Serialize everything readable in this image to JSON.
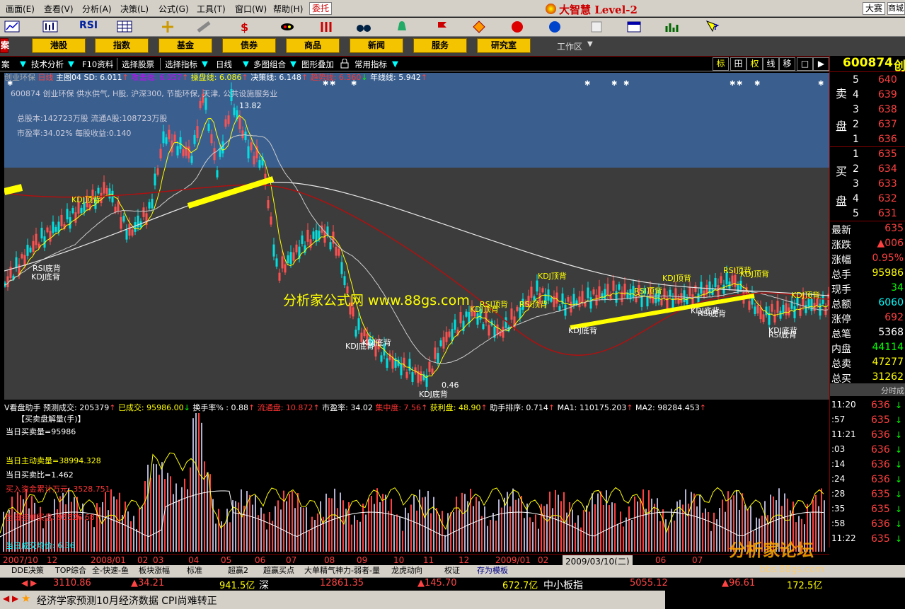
{
  "menu": {
    "items": [
      "画面(E)",
      "查看(V)",
      "分析(A)",
      "决策(L)",
      "公式(G)",
      "工具(T)",
      "窗口(W)",
      "帮助(H)"
    ],
    "trade": "委托",
    "brand": "大智慧 Level-2",
    "dasai": "大赛",
    "shangcheng": "商城"
  },
  "toolbar": {
    "icons": [
      "chart-icon",
      "kline-icon",
      "rsi-icon",
      "table-icon",
      "crosshair-icon",
      "ruler-icon",
      "dollar-icon",
      "eye-icon",
      "bars-icon",
      "binoculars-icon",
      "bell-icon",
      "flag-icon",
      "diamond-icon",
      "red-circle-icon",
      "blue-circle-icon",
      "document-icon",
      "window-icon",
      "barchart-icon",
      "help-icon"
    ],
    "rsi_label": "RSI"
  },
  "sector": {
    "left_tab": "案",
    "buttons": [
      "港股",
      "指数",
      "基金",
      "债券",
      "商品",
      "新闻",
      "服务",
      "研究室"
    ],
    "workspace": "工作区"
  },
  "funcbar": {
    "items": [
      "案",
      "技术分析",
      "F10资料",
      "选择股票",
      "选择指标",
      "日线",
      "多图组合",
      "图形叠加",
      "常用指标"
    ],
    "right_buttons": [
      "标",
      "田",
      "权",
      "线",
      "移",
      "□",
      "▶"
    ]
  },
  "stock": {
    "code": "600874",
    "name_suffix": "创",
    "chart_title": "创业环保",
    "period": "日线",
    "main_indicator": "主图04",
    "sd": "SD: 6.011",
    "attack": "攻击线: 6.057",
    "operate": "操盘线: 6.086",
    "decision": "决策线: 6.148",
    "trend": "趋势线: 6.360",
    "year": "年线线: 5.942",
    "desc": "600874 创业环保 供水供气, H股, 沪深300, 节能环保, 天津, 公共设施服务业",
    "total_shares": "总股本:142723万股  流通A股:108723万股",
    "pe": "市盈率:34.02% 每股收益:0.140",
    "high_label": "13.82",
    "low_label": "0.46",
    "watermark": "分析家公式网  www.88gs.com"
  },
  "chart_labels": [
    {
      "t": "RSI底背"
    },
    {
      "t": "KDJ底背"
    },
    {
      "t": "KDJ顶背"
    },
    {
      "t": "KDJ底背"
    },
    {
      "t": "KDJ底背"
    },
    {
      "t": "KDJ底背"
    },
    {
      "t": "KDJ顶背"
    },
    {
      "t": "RSI顶背"
    },
    {
      "t": "RSI顶背"
    },
    {
      "t": "KDJ顶背"
    },
    {
      "t": "KDJ底背"
    },
    {
      "t": "RSI顶背"
    },
    {
      "t": "KDJ顶背"
    },
    {
      "t": "KDJ底背"
    },
    {
      "t": "RSI底背"
    },
    {
      "t": "RSI顶背"
    },
    {
      "t": "KDJ顶背"
    },
    {
      "t": "KDJ顶背"
    },
    {
      "t": "KDJ底背"
    },
    {
      "t": "RSI底背"
    }
  ],
  "lower": {
    "header_parts": [
      "V看盘助手 预测成交: 205379",
      "已成交: 95986.00",
      "换手率% : 0.88",
      "流通盘: 10.872",
      "市盈率: 34.02",
      "集中度: 7.56",
      "获利盘: 48.90",
      "助手排序: 0.714",
      "MA1: 110175.203",
      "MA2: 98284.453"
    ],
    "title": "【买卖盘解量(手)】",
    "buy_vol": "当日买卖量=95986",
    "active_sell": "当日主动卖量=38994.328",
    "ratio": "当日买卖比=1.462",
    "funds": "买入资金累计万元: 3528.751",
    "pending": "当日挂单买盘: 95526.68",
    "bottom_text": "当日成交均价: 6.36"
  },
  "dates": [
    "2007/10",
    "12",
    "2008/01",
    "02",
    "03",
    "04",
    "05",
    "06",
    "07",
    "08",
    "09",
    "10",
    "11",
    "12",
    "2009/01",
    "02",
    "2009/03/10(二)",
    "06",
    "07"
  ],
  "quotes": {
    "sell_label": [
      "卖",
      "盘"
    ],
    "buy_label": [
      "买",
      "盘"
    ],
    "sells": [
      {
        "n": "5",
        "p": "640"
      },
      {
        "n": "4",
        "p": "639"
      },
      {
        "n": "3",
        "p": "638"
      },
      {
        "n": "2",
        "p": "637"
      },
      {
        "n": "1",
        "p": "636"
      }
    ],
    "buys": [
      {
        "n": "1",
        "p": "635"
      },
      {
        "n": "2",
        "p": "634"
      },
      {
        "n": "3",
        "p": "633"
      },
      {
        "n": "4",
        "p": "632"
      },
      {
        "n": "5",
        "p": "631"
      }
    ],
    "stats": [
      {
        "k": "最新",
        "v": "635",
        "c": "#ff4040"
      },
      {
        "k": "涨跌",
        "v": "▲006",
        "c": "#ff4040"
      },
      {
        "k": "涨幅",
        "v": "0.95%",
        "c": "#ff4040"
      },
      {
        "k": "总手",
        "v": "95986",
        "c": "#ffff00"
      },
      {
        "k": "现手",
        "v": "34",
        "c": "#00ff00"
      },
      {
        "k": "总额",
        "v": "6060",
        "c": "#00ffff"
      },
      {
        "k": "涨停",
        "v": "692",
        "c": "#ff4040"
      },
      {
        "k": "总笔",
        "v": "5368",
        "c": "#ffffff"
      },
      {
        "k": "内盘",
        "v": "44114",
        "c": "#00ff00"
      },
      {
        "k": "总卖",
        "v": "47277",
        "c": "#ffff00"
      },
      {
        "k": "总买",
        "v": "31262",
        "c": "#ffff00"
      }
    ],
    "ticks_title": "分时成",
    "ticks": [
      {
        "t": "11:20",
        "p": "636"
      },
      {
        "t": ":57",
        "p": "635"
      },
      {
        "t": "11:21",
        "p": "636"
      },
      {
        "t": ":03",
        "p": "636"
      },
      {
        "t": ":14",
        "p": "636"
      },
      {
        "t": ":24",
        "p": "636"
      },
      {
        "t": ":28",
        "p": "635"
      },
      {
        "t": ":35",
        "p": "635"
      },
      {
        "t": ":58",
        "p": "636"
      },
      {
        "t": "11:22",
        "p": "635"
      }
    ]
  },
  "tabs": [
    "DDE决策",
    "TOP综合",
    "全-快速-鱼",
    "板块涨幅",
    "标准",
    "超赢2",
    "超赢买点",
    "大单精气神力-弱者-量",
    "龙虎动向",
    "权证",
    "存为模板"
  ],
  "indexbar": {
    "sh_index": "3110.86",
    "sh_change": "▲34.21",
    "sh_amount": "941.5亿",
    "sz_label": "深",
    "sz_index": "12861.35",
    "sz_change": "▲145.70",
    "sz_amount": "672.7亿",
    "sme_label": "中小板指",
    "sme_index": "5055.12",
    "sme_change": "▲96.61",
    "sme_amount": "172.5亿"
  },
  "ticker": "经济学家预测10月经济数据 CPI尚难转正",
  "watermark2": {
    "title": "分析家论坛",
    "url": "bbs.88gs.com"
  }
}
